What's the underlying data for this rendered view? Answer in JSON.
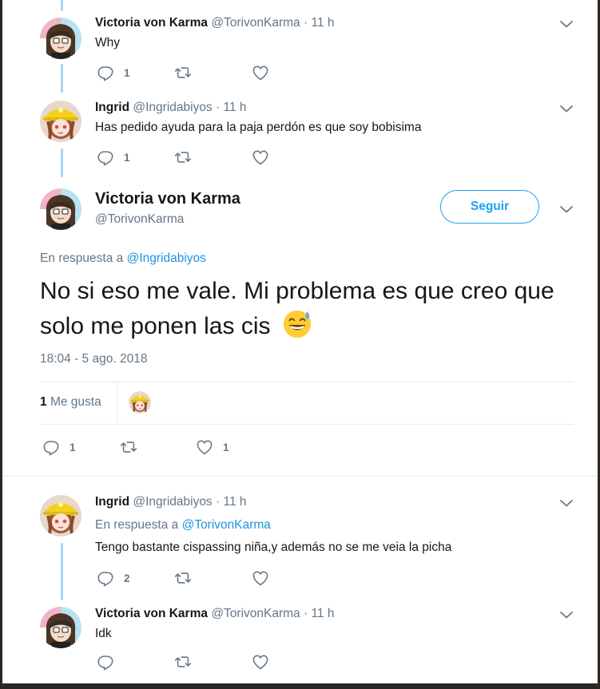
{
  "tweets": [
    {
      "name": "Victoria von Karma",
      "handle": "@TorivonKarma",
      "time": "· 11 h",
      "text": "Why",
      "reply_count": "1",
      "avatar": "victoria-avatar"
    },
    {
      "name": "Ingrid",
      "handle": "@Ingridabiyos",
      "time": "· 11 h",
      "text": "Has pedido ayuda para la paja perdón es que soy bobisima",
      "reply_count": "1",
      "avatar": "ingrid-avatar"
    }
  ],
  "main": {
    "name": "Victoria von Karma",
    "handle": "@TorivonKarma",
    "follow_label": "Seguir",
    "reply_prefix": "En respuesta a",
    "reply_to": "@Ingridabiyos",
    "text": "No si eso me vale. Mi problema es que creo que solo me ponen las cis",
    "emoji": "smiling-face-with-open-mouth-and-cold-sweat",
    "timestamp": "18:04 - 5 ago. 2018",
    "likes_count": "1",
    "likes_label": "Me gusta",
    "reply_count": "1",
    "like_count": "1"
  },
  "replies": [
    {
      "name": "Ingrid",
      "handle": "@Ingridabiyos",
      "time": "· 11 h",
      "reply_prefix": "En respuesta a",
      "reply_to": "@TorivonKarma",
      "text": "Tengo bastante cispassing niña,y además no se me veia la picha",
      "reply_count": "2",
      "avatar": "ingrid-avatar"
    },
    {
      "name": "Victoria von Karma",
      "handle": "@TorivonKarma",
      "time": "· 11 h",
      "text": "Idk",
      "reply_count": "",
      "avatar": "victoria-avatar"
    }
  ],
  "colors": {
    "accent": "#1da1f2",
    "link": "#1b95e0",
    "muted": "#657786",
    "thread_line": "#a8d4f7"
  }
}
